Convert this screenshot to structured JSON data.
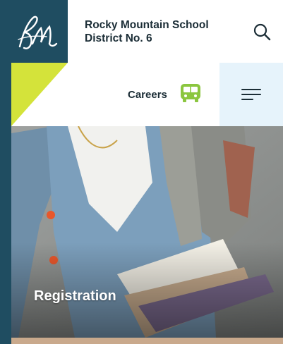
{
  "header": {
    "title_line1": "Rocky Mountain School",
    "title_line2": "District No. 6",
    "logo_icon": "rm-monogram-logo",
    "search_icon": "search-icon"
  },
  "nav": {
    "careers_label": "Careers",
    "bus_icon": "bus-icon",
    "menu_icon": "menu-icon"
  },
  "hero": {
    "label": "Registration"
  },
  "colors": {
    "brand_dark": "#1f4d61",
    "accent_lime": "#d4e33a",
    "accent_green": "#8bc63f",
    "menu_bg": "#e6f3fb"
  }
}
